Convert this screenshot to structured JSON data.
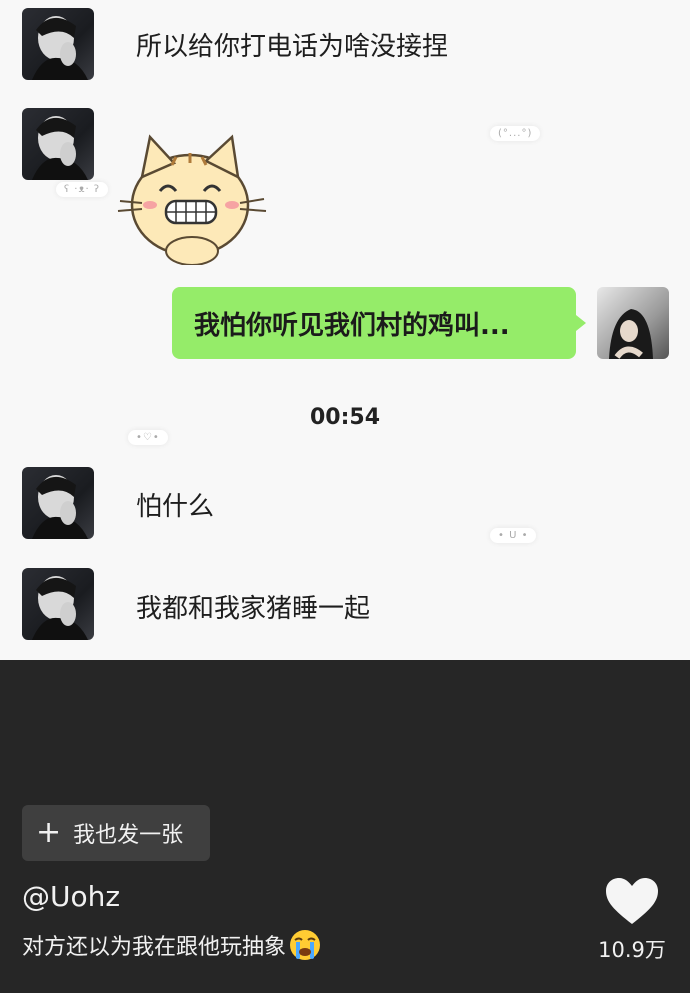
{
  "chat": {
    "messages": [
      {
        "side": "left",
        "text": "所以给你打电话为啥没接捏"
      },
      {
        "side": "left",
        "type": "sticker",
        "sticker": "grinning-cat"
      },
      {
        "side": "right",
        "text": "我怕你听见我们村的鸡叫..."
      },
      {
        "side": "left",
        "text": "怕什么"
      },
      {
        "side": "left",
        "text": "我都和我家猪睡一起"
      }
    ],
    "timestamp": "00:54",
    "decorations": [
      "(°...°)",
      "ʕ ·ᴥ· ʔ",
      "•♡•",
      "• U •"
    ]
  },
  "post_button": {
    "icon": "plus-icon",
    "label": "我也发一张"
  },
  "author": "@Uohz",
  "caption": "对方还以为我在跟他玩抽象",
  "caption_emoji": "crying-face-icon",
  "likes": {
    "icon": "heart-icon",
    "count": "10.9万"
  },
  "colors": {
    "bubble_green": "#95ec69",
    "bottom_bg": "#262626",
    "chat_bg": "#f8f8f8"
  }
}
